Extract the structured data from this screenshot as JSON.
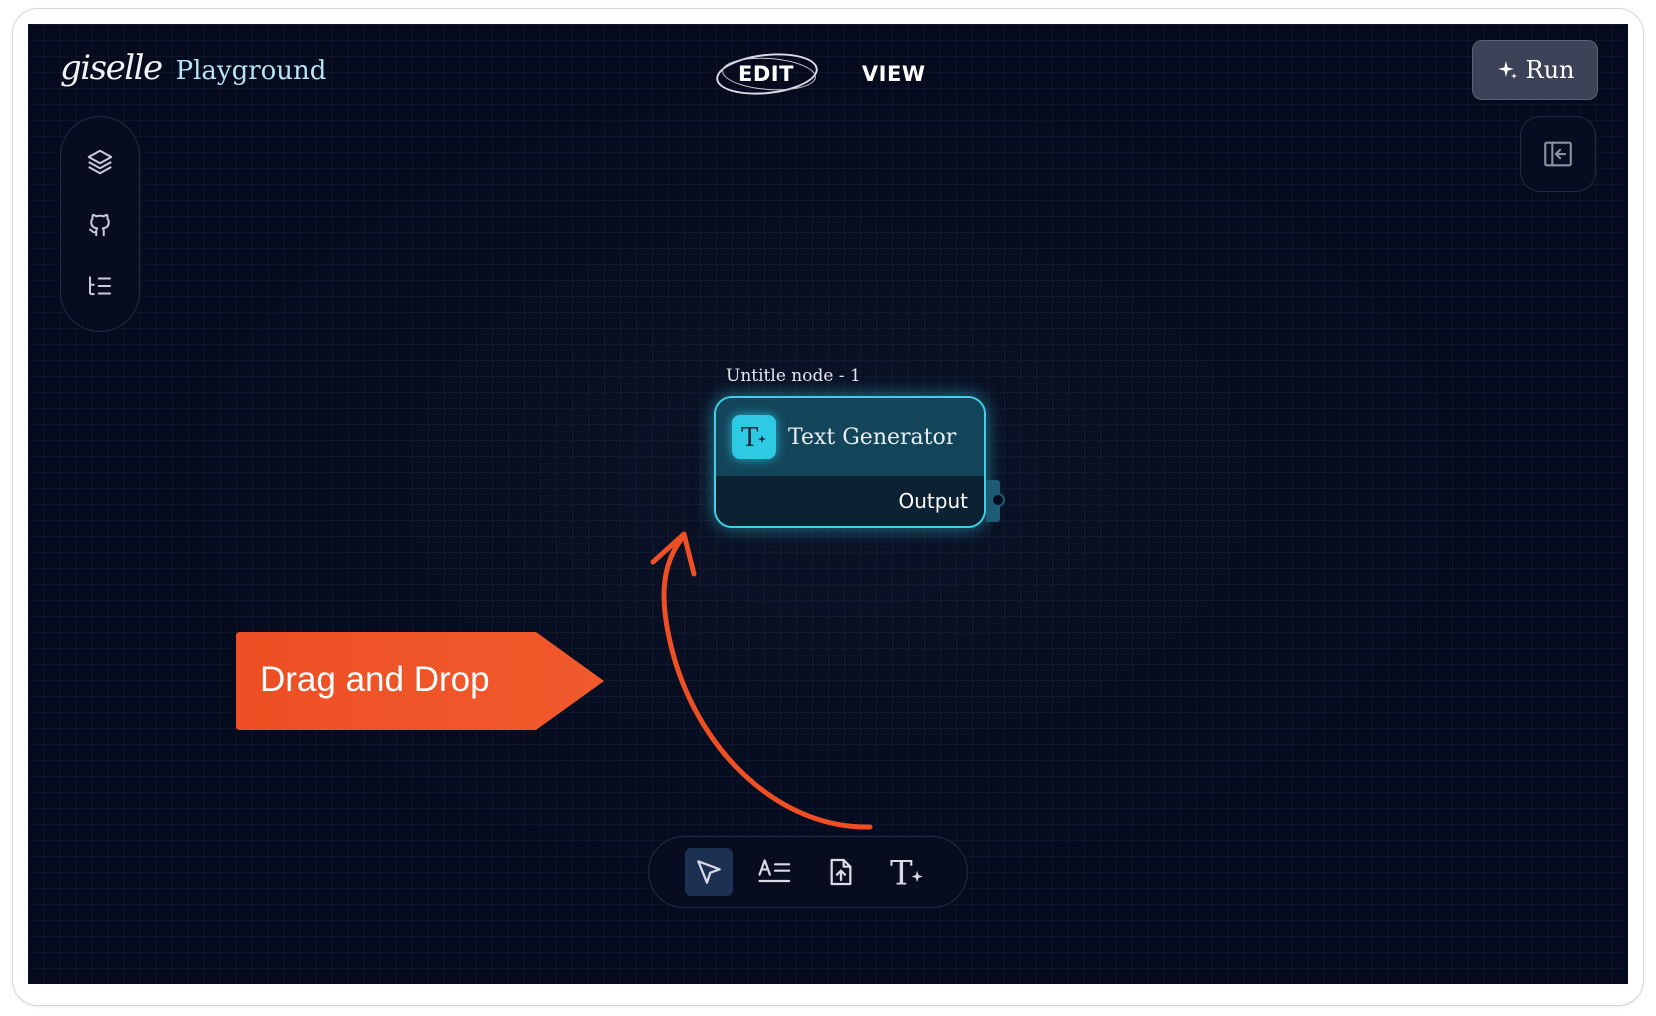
{
  "header": {
    "logo_text": "giselle",
    "subtitle": "Playground",
    "tabs": [
      {
        "label": "EDIT",
        "active": true
      },
      {
        "label": "VIEW",
        "active": false
      }
    ],
    "run_label": "Run"
  },
  "left_toolbar": {
    "items": [
      {
        "icon": "layers-icon"
      },
      {
        "icon": "github-icon"
      },
      {
        "icon": "list-tree-icon"
      }
    ]
  },
  "right_panel": {
    "icon": "panel-collapse-icon"
  },
  "node": {
    "title": "Untitle node - 1",
    "type_label": "Text Generator",
    "icon": "text-generator-icon",
    "output_label": "Output",
    "accent_color": "#3fd0e8"
  },
  "annotation": {
    "text": "Drag and Drop",
    "color": "#ee4f24"
  },
  "bottom_toolbar": {
    "tools": [
      {
        "icon": "pointer-icon",
        "active": true
      },
      {
        "icon": "text-input-icon",
        "active": false
      },
      {
        "icon": "file-upload-icon",
        "active": false
      },
      {
        "icon": "text-generator-tool-icon",
        "active": false
      }
    ]
  }
}
